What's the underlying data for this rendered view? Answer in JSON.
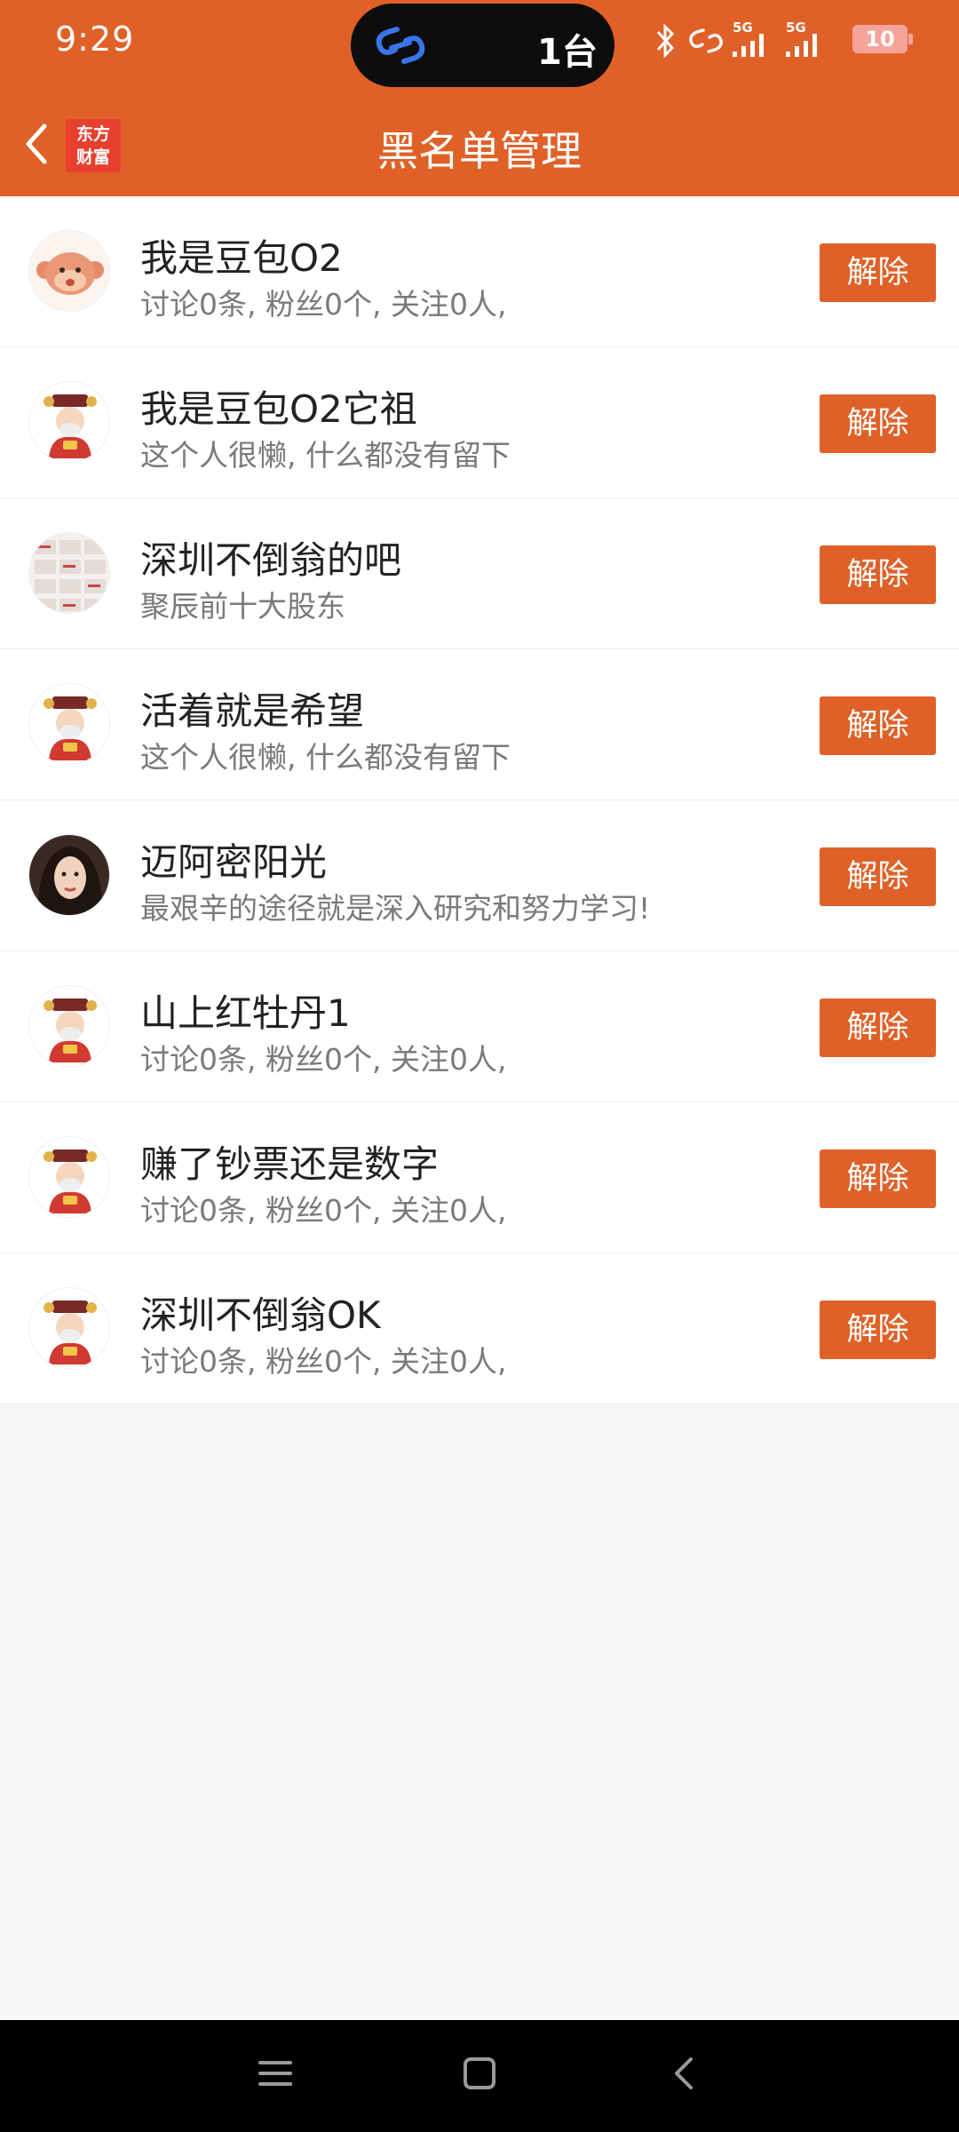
{
  "status_bar": {
    "time": "9:29",
    "pill_text": "1台",
    "network_label_1": "5G",
    "network_label_2": "5G",
    "battery": "10"
  },
  "header": {
    "logo_line1": "东方",
    "logo_line2": "财富",
    "title": "黑名单管理",
    "accent_color": "#df6128"
  },
  "list": {
    "button_label": "解除",
    "items": [
      {
        "name": "我是豆包O2",
        "desc": "讨论0条, 粉丝0个, 关注0人,",
        "avatar": "monkey-avatar"
      },
      {
        "name": "我是豆包O2它祖",
        "desc": "这个人很懒, 什么都没有留下",
        "avatar": "fortune-god-avatar"
      },
      {
        "name": "深圳不倒翁的吧",
        "desc": "聚辰前十大股东",
        "avatar": "calendar-avatar"
      },
      {
        "name": "活着就是希望",
        "desc": "这个人很懒, 什么都没有留下",
        "avatar": "fortune-god-avatar"
      },
      {
        "name": "迈阿密阳光",
        "desc": "最艰辛的途径就是深入研究和努力学习!",
        "avatar": "woman-photo-avatar"
      },
      {
        "name": "山上红牡丹1",
        "desc": "讨论0条, 粉丝0个, 关注0人,",
        "avatar": "fortune-god-avatar"
      },
      {
        "name": "赚了钞票还是数字",
        "desc": "讨论0条, 粉丝0个, 关注0人,",
        "avatar": "fortune-god-avatar"
      },
      {
        "name": "深圳不倒翁OK",
        "desc": "讨论0条, 粉丝0个, 关注0人,",
        "avatar": "fortune-god-avatar"
      }
    ]
  }
}
